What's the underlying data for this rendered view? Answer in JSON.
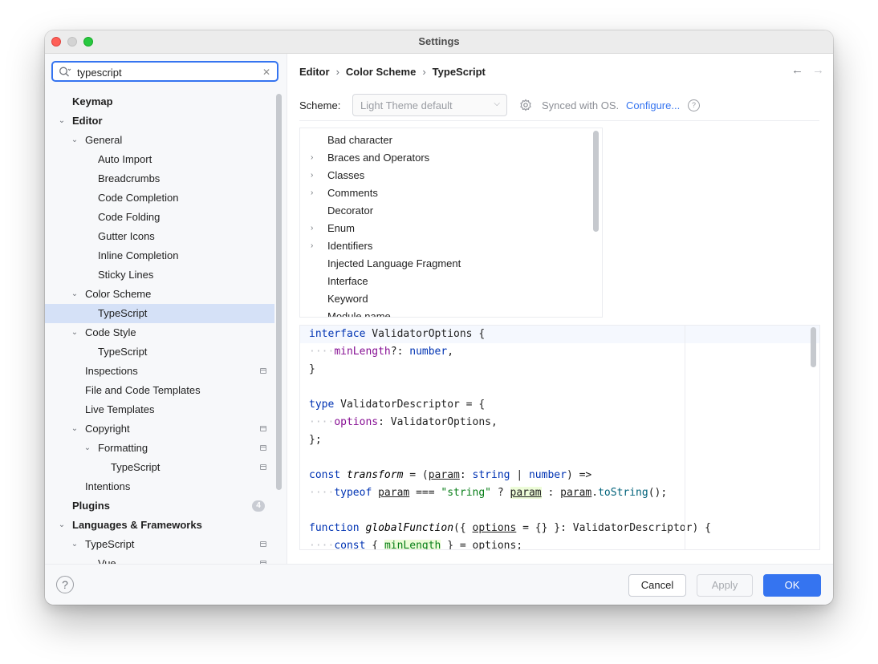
{
  "window": {
    "title": "Settings"
  },
  "search": {
    "value": "typescript",
    "placeholder": ""
  },
  "sidebar": {
    "items": [
      {
        "label": "Keymap",
        "level": 0,
        "bold": true,
        "expand": "none"
      },
      {
        "label": "Editor",
        "level": 0,
        "bold": true,
        "expand": "open"
      },
      {
        "label": "General",
        "level": 1,
        "bold": false,
        "expand": "open"
      },
      {
        "label": "Auto Import",
        "level": 2,
        "bold": false,
        "expand": "none"
      },
      {
        "label": "Breadcrumbs",
        "level": 2,
        "bold": false,
        "expand": "none"
      },
      {
        "label": "Code Completion",
        "level": 2,
        "bold": false,
        "expand": "none"
      },
      {
        "label": "Code Folding",
        "level": 2,
        "bold": false,
        "expand": "none"
      },
      {
        "label": "Gutter Icons",
        "level": 2,
        "bold": false,
        "expand": "none"
      },
      {
        "label": "Inline Completion",
        "level": 2,
        "bold": false,
        "expand": "none"
      },
      {
        "label": "Sticky Lines",
        "level": 2,
        "bold": false,
        "expand": "none"
      },
      {
        "label": "Color Scheme",
        "level": 1,
        "bold": false,
        "expand": "open"
      },
      {
        "label": "TypeScript",
        "level": 2,
        "bold": false,
        "expand": "none",
        "selected": true
      },
      {
        "label": "Code Style",
        "level": 1,
        "bold": false,
        "expand": "open"
      },
      {
        "label": "TypeScript",
        "level": 2,
        "bold": false,
        "expand": "none"
      },
      {
        "label": "Inspections",
        "level": 1,
        "bold": false,
        "expand": "none",
        "project_icon": true
      },
      {
        "label": "File and Code Templates",
        "level": 1,
        "bold": false,
        "expand": "none"
      },
      {
        "label": "Live Templates",
        "level": 1,
        "bold": false,
        "expand": "none"
      },
      {
        "label": "Copyright",
        "level": 1,
        "bold": false,
        "expand": "open",
        "project_icon": true
      },
      {
        "label": "Formatting",
        "level": 2,
        "bold": false,
        "expand": "open",
        "project_icon": true
      },
      {
        "label": "TypeScript",
        "level": 3,
        "bold": false,
        "expand": "none",
        "project_icon": true
      },
      {
        "label": "Intentions",
        "level": 1,
        "bold": false,
        "expand": "none"
      },
      {
        "label": "Plugins",
        "level": 0,
        "bold": true,
        "expand": "none",
        "badge": "4"
      },
      {
        "label": "Languages & Frameworks",
        "level": 0,
        "bold": true,
        "expand": "open"
      },
      {
        "label": "TypeScript",
        "level": 1,
        "bold": false,
        "expand": "open",
        "project_icon": true
      },
      {
        "label": "Vue",
        "level": 2,
        "bold": false,
        "expand": "none",
        "project_icon": true
      }
    ]
  },
  "breadcrumb": [
    "Editor",
    "Color Scheme",
    "TypeScript"
  ],
  "scheme": {
    "label": "Scheme:",
    "value": "Light Theme default",
    "synced_text": "Synced with OS.",
    "configure_link": "Configure..."
  },
  "categories": [
    {
      "label": "Bad character",
      "expandable": false
    },
    {
      "label": "Braces and Operators",
      "expandable": true
    },
    {
      "label": "Classes",
      "expandable": true
    },
    {
      "label": "Comments",
      "expandable": true
    },
    {
      "label": "Decorator",
      "expandable": false
    },
    {
      "label": "Enum",
      "expandable": true
    },
    {
      "label": "Identifiers",
      "expandable": true
    },
    {
      "label": "Injected Language Fragment",
      "expandable": false
    },
    {
      "label": "Interface",
      "expandable": false
    },
    {
      "label": "Keyword",
      "expandable": false
    },
    {
      "label": "Module name",
      "expandable": false
    }
  ],
  "code_preview": {
    "lines": [
      "interface ValidatorOptions {",
      "····minLength?: number,",
      "}",
      "",
      "type ValidatorDescriptor = {",
      "····options: ValidatorOptions,",
      "};",
      "",
      "const transform = (param: string | number) =>",
      "····typeof param === \"string\" ? param : param.toString();",
      "",
      "function globalFunction({ options = {} }: ValidatorDescriptor) {",
      "····const { minLength } = options;"
    ]
  },
  "footer": {
    "cancel": "Cancel",
    "apply": "Apply",
    "ok": "OK",
    "help": "?"
  },
  "colors": {
    "accent": "#3574f0",
    "selection": "#d5e1f7",
    "keyword": "#0033b3",
    "property": "#871094",
    "string": "#067d17"
  },
  "icons": {
    "search": "search-icon",
    "clear": "clear-search-icon",
    "gear": "gear-icon",
    "back": "arrow-left-icon",
    "forward": "arrow-right-icon",
    "help": "help-icon",
    "project": "project-level-icon"
  }
}
